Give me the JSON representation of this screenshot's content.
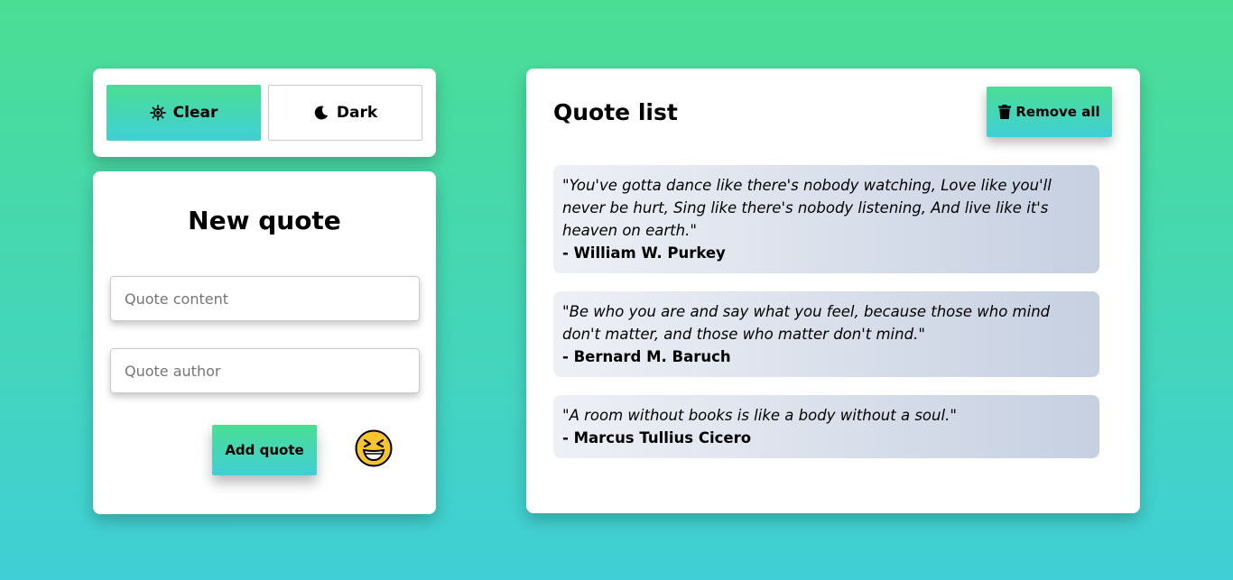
{
  "theme": {
    "clear_label": "Clear",
    "dark_label": "Dark",
    "clear_icon": "sun-icon",
    "dark_icon": "moon-icon"
  },
  "new_quote": {
    "title": "New quote",
    "content_placeholder": "Quote content",
    "author_placeholder": "Quote author",
    "content_value": "",
    "author_value": "",
    "add_label": "Add quote",
    "emoji_icon": "laughing-face-icon"
  },
  "quote_list": {
    "title": "Quote list",
    "remove_all_label": "Remove all",
    "remove_icon": "trash-icon",
    "quotes": [
      {
        "text": "You've gotta dance like there's nobody watching, Love like you'll never be hurt, Sing like there's nobody listening, And live like it's heaven on earth.",
        "author": "- William W. Purkey"
      },
      {
        "text": "Be who you are and say what you feel, because those who mind don't matter, and those who matter don't mind.",
        "author": "- Bernard M. Baruch"
      },
      {
        "text": "A room without books is like a body without a soul.",
        "author": "- Marcus Tullius Cicero"
      }
    ]
  },
  "colors": {
    "gradient_top": "#4ade94",
    "gradient_bottom": "#40cfd6",
    "quote_bg_left": "#eef0f6",
    "quote_bg_right": "#c6d0e1"
  }
}
